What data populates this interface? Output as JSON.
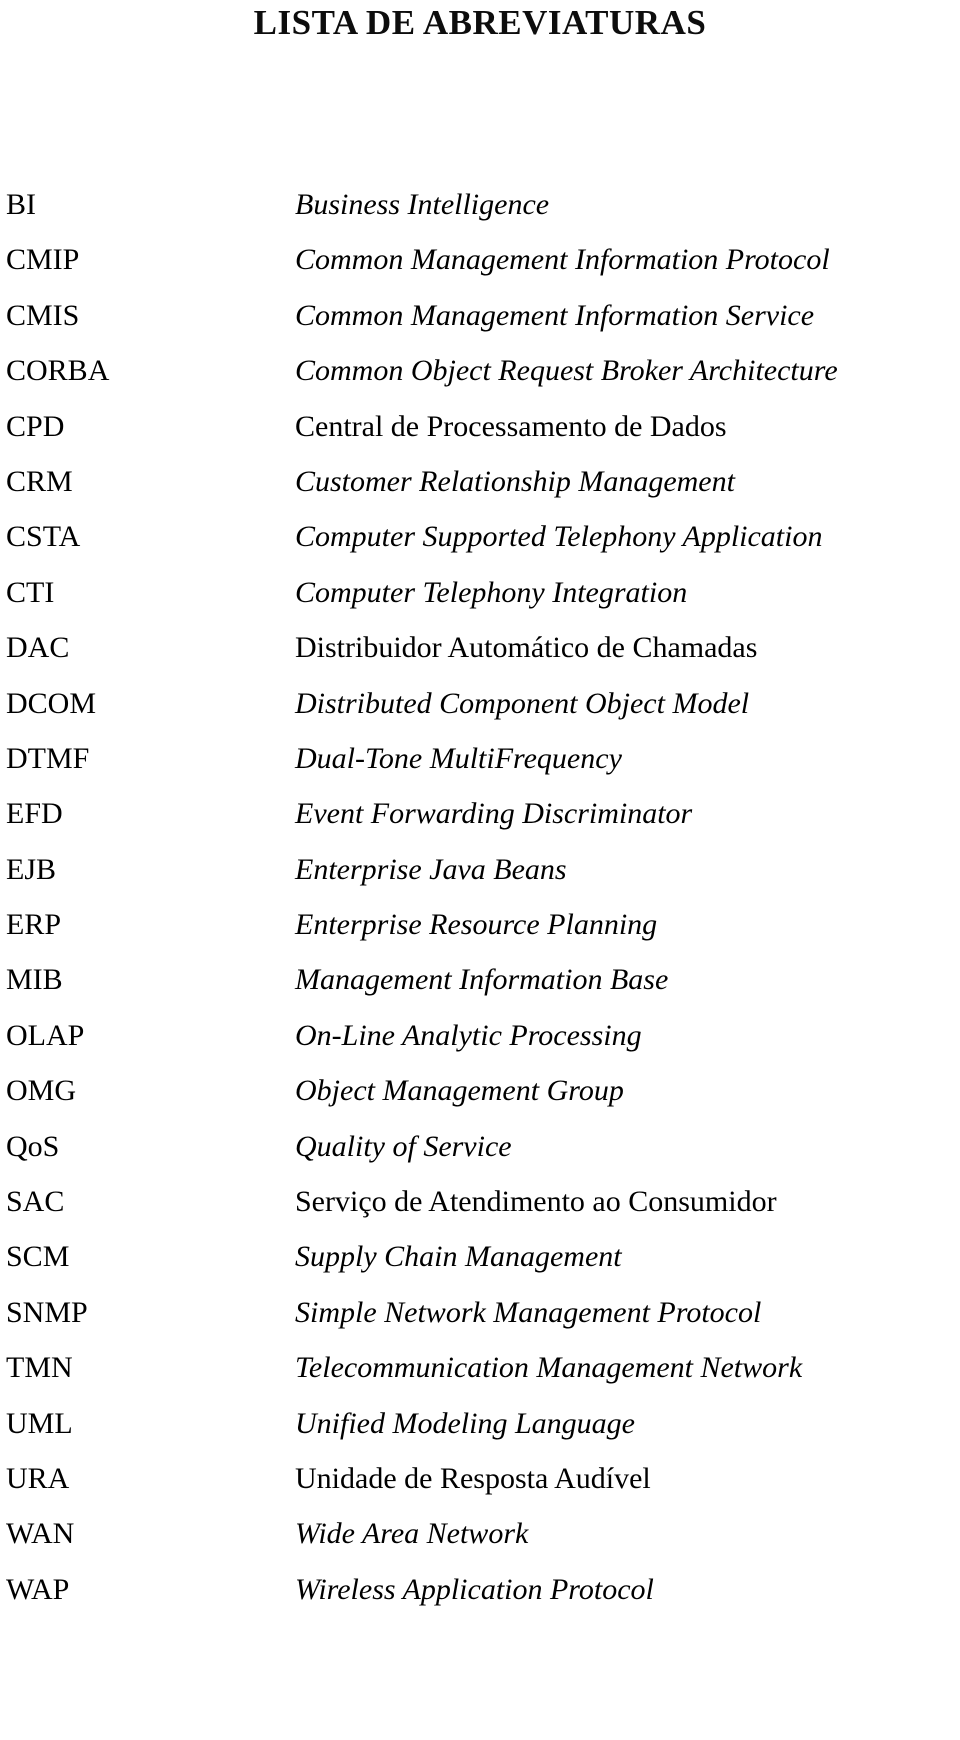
{
  "document": {
    "title": "LISTA DE ABREVIATURAS",
    "language": "pt-BR",
    "entries": [
      {
        "term": "BI",
        "definition": "Business Intelligence",
        "italic": true
      },
      {
        "term": "CMIP",
        "definition": "Common Management Information Protocol",
        "italic": true
      },
      {
        "term": "CMIS",
        "definition": "Common Management Information Service",
        "italic": true
      },
      {
        "term": "CORBA",
        "definition": "Common Object Request Broker Architecture",
        "italic": true
      },
      {
        "term": "CPD",
        "definition": "Central de Processamento de Dados",
        "italic": false
      },
      {
        "term": "CRM",
        "definition": "Customer Relationship Management",
        "italic": true
      },
      {
        "term": "CSTA",
        "definition": "Computer Supported Telephony Application",
        "italic": true
      },
      {
        "term": "CTI",
        "definition": "Computer Telephony Integration",
        "italic": true
      },
      {
        "term": "DAC",
        "definition": "Distribuidor Automático de Chamadas",
        "italic": false
      },
      {
        "term": "DCOM",
        "definition": "Distributed Component Object Model",
        "italic": true
      },
      {
        "term": "DTMF",
        "definition": "Dual-Tone MultiFrequency",
        "italic": true
      },
      {
        "term": "EFD",
        "definition": "Event Forwarding Discriminator",
        "italic": true
      },
      {
        "term": "EJB",
        "definition": "Enterprise Java Beans",
        "italic": true
      },
      {
        "term": "ERP",
        "definition": "Enterprise Resource Planning",
        "italic": true
      },
      {
        "term": "MIB",
        "definition": "Management Information Base",
        "italic": true
      },
      {
        "term": "OLAP",
        "definition": "On-Line Analytic Processing",
        "italic": true
      },
      {
        "term": "OMG",
        "definition": "Object Management Group",
        "italic": true
      },
      {
        "term": "QoS",
        "definition": "Quality of Service",
        "italic": true
      },
      {
        "term": "SAC",
        "definition": "Serviço de Atendimento ao Consumidor",
        "italic": false
      },
      {
        "term": "SCM",
        "definition": "Supply Chain Management",
        "italic": true
      },
      {
        "term": "SNMP",
        "definition": "Simple Network Management Protocol",
        "italic": true
      },
      {
        "term": "TMN",
        "definition": "Telecommunication Management Network",
        "italic": true
      },
      {
        "term": "UML",
        "definition": "Unified Modeling Language",
        "italic": true
      },
      {
        "term": "URA",
        "definition": "Unidade de Resposta Audível",
        "italic": false
      },
      {
        "term": "WAN",
        "definition": "Wide Area Network",
        "italic": true
      },
      {
        "term": "WAP",
        "definition": "Wireless Application Protocol",
        "italic": true
      }
    ]
  }
}
